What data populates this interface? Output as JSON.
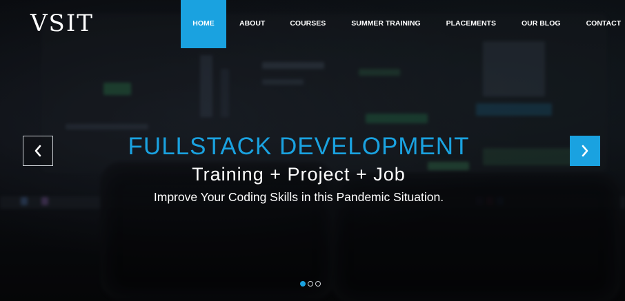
{
  "header": {
    "logo_text": "VSIT",
    "nav": [
      {
        "label": "HOME",
        "active": true
      },
      {
        "label": "ABOUT",
        "active": false
      },
      {
        "label": "COURSES",
        "active": false
      },
      {
        "label": "SUMMER TRAINING",
        "active": false
      },
      {
        "label": "PLACEMENTS",
        "active": false
      },
      {
        "label": "OUR BLOG",
        "active": false
      },
      {
        "label": "CONTACT",
        "active": false
      }
    ]
  },
  "slider": {
    "title": "FULLSTACK DEVELOPMENT",
    "subtitle": "Training + Project + Job",
    "text": "Improve Your Coding Skills in this Pandemic Situation.",
    "prev_icon": "chevron-left-icon",
    "next_icon": "chevron-right-icon",
    "dots": [
      {
        "active": true
      },
      {
        "active": false
      },
      {
        "active": false
      }
    ]
  },
  "colors": {
    "accent": "#1aa2e0",
    "text": "#ffffff",
    "background": "#0e1116"
  }
}
